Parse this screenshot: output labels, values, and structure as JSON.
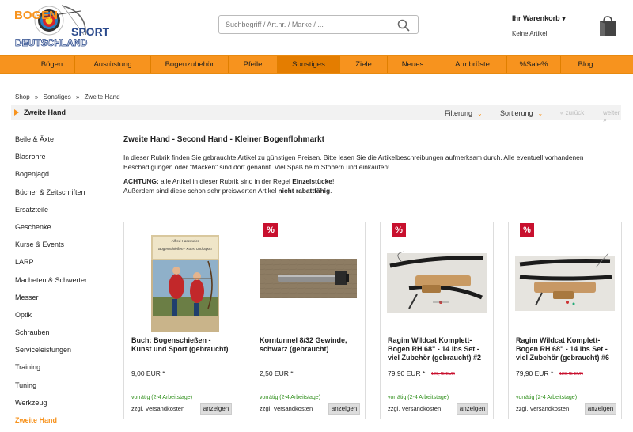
{
  "logo": {
    "line1": "BOGEN",
    "line2": "SPORT",
    "line3": "DEUTSCHLAND"
  },
  "search": {
    "placeholder": "Suchbegriff / Art.nr. / Marke / ..."
  },
  "cart": {
    "title": "Ihr Warenkorb",
    "status": "Keine Artikel."
  },
  "nav": [
    "Bögen",
    "Ausrüstung",
    "Bogenzubehör",
    "Pfeile",
    "Sonstiges",
    "Ziele",
    "Neues",
    "Armbrüste",
    "%Sale%",
    "Blog"
  ],
  "breadcrumb": [
    "Shop",
    "»",
    "Sonstiges",
    "»",
    "Zweite Hand"
  ],
  "filterbar": {
    "title": "Zweite Hand",
    "filter": "Filterung",
    "sort": "Sortierung",
    "prev": "« zurück",
    "next": "weiter »"
  },
  "sidebar": [
    "Beile & Äxte",
    "Blasrohre",
    "Bogenjagd",
    "Bücher & Zeitschriften",
    "Ersatzteile",
    "Geschenke",
    "Kurse & Events",
    "LARP",
    "Macheten & Schwerter",
    "Messer",
    "Optik",
    "Schrauben",
    "Serviceleistungen",
    "Training",
    "Tuning",
    "Werkzeug",
    "Zweite Hand"
  ],
  "content": {
    "heading": "Zweite Hand - Second Hand - Kleiner Bogenflohmarkt",
    "intro": "In dieser Rubrik finden Sie gebrauchte Artikel zu günstigen Preisen. Bitte lesen Sie die Artikelbeschreibungen aufmerksam durch. Alle eventuell vorhandenen Beschädigungen oder \"Macken\" sind dort genannt. Viel Spaß beim Stöbern und einkaufen!",
    "warn_label": "ACHTUNG:",
    "warn_text1": " alle Artikel in dieser Rubrik sind in der Regel ",
    "warn_bold1": "Einzelstücke",
    "warn_text2": "!",
    "warn_text3": "Außerdem sind diese schon sehr preiswerten Artikel ",
    "warn_bold2": "nicht rabattfähig",
    "warn_text4": "."
  },
  "book": {
    "author": "Alfred Hasemeier",
    "title": "Bogenschießen - Kunst und Sport"
  },
  "products": [
    {
      "name": "Buch: Bogenschießen - Kunst und Sport (gebraucht)",
      "price": "9,00 EUR *",
      "old": "",
      "sale": "",
      "availability": "vorrätig (2-4 Arbeitstage)",
      "shipping": "zzgl. Versandkosten",
      "button": "anzeigen"
    },
    {
      "name": "Korntunnel 8/32 Gewinde, schwarz (gebraucht)",
      "price": "2,50 EUR *",
      "old": "",
      "sale": "%",
      "availability": "vorrätig (2-4 Arbeitstage)",
      "shipping": "zzgl. Versandkosten",
      "button": "anzeigen"
    },
    {
      "name": "Ragim Wildcat Komplett-Bogen RH 68\" - 14 lbs Set - viel Zubehör (gebraucht) #2",
      "price": "79,90 EUR *",
      "old": "129,45 EUR",
      "sale": "%",
      "availability": "vorrätig (2-4 Arbeitstage)",
      "shipping": "zzgl. Versandkosten",
      "button": "anzeigen"
    },
    {
      "name": "Ragim Wildcat Komplett-Bogen RH 68\" - 14 lbs Set - viel Zubehör (gebraucht) #6",
      "price": "79,90 EUR *",
      "old": "129,45 EUR",
      "sale": "%",
      "availability": "vorrätig (2-4 Arbeitstage)",
      "shipping": "zzgl. Versandkosten",
      "button": "anzeigen"
    }
  ],
  "colors": {
    "accent": "#f7931e",
    "sale": "#c8102e",
    "available": "#2f8f1b"
  }
}
